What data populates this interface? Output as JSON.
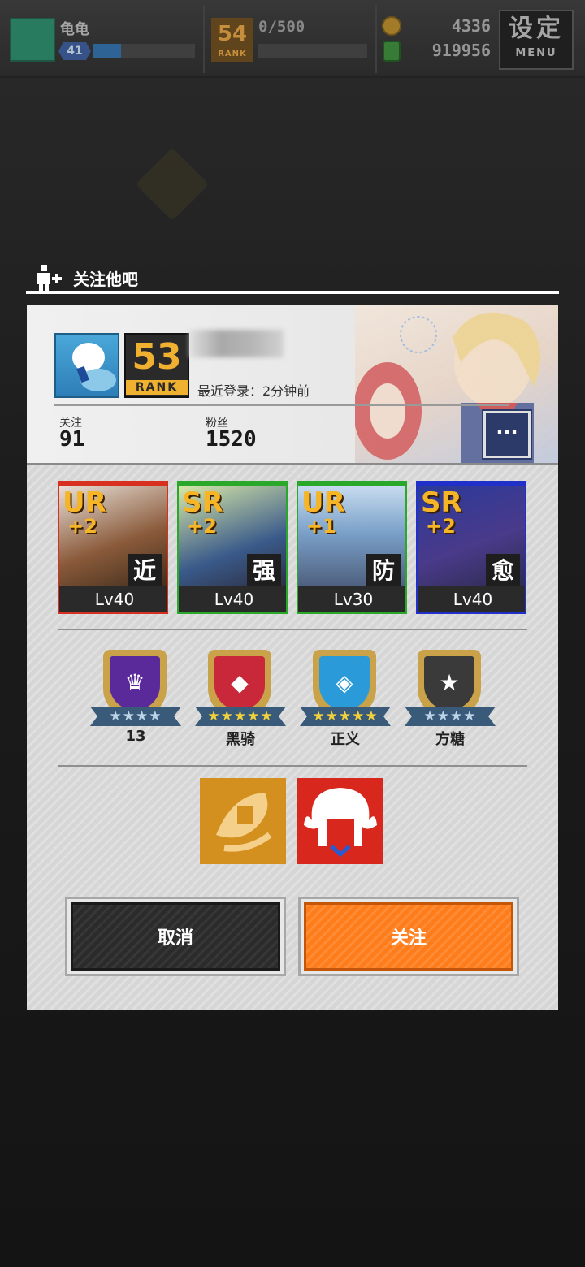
{
  "topbar": {
    "player_name": "龟龟",
    "player_level": "41",
    "exp_fraction": 0.28,
    "rank_label": "RANK",
    "rank_number": "54",
    "rank_points": "0/500",
    "coins": "4336",
    "gems": "919956",
    "menu_label": "设定",
    "menu_sub": "MENU"
  },
  "dialog": {
    "title": "关注他吧",
    "rank_number": "53",
    "rank_label": "RANK",
    "last_login": "最近登录：2分钟前",
    "following_label": "关注",
    "following_value": "91",
    "fans_label": "粉丝",
    "fans_value": "1520",
    "more_label": "···"
  },
  "cards": [
    {
      "rarity": "UR",
      "plus": "+2",
      "role": "近",
      "level": "Lv40",
      "frame_color": "#d83020"
    },
    {
      "rarity": "SR",
      "plus": "+2",
      "role": "强",
      "level": "Lv40",
      "frame_color": "#2aa82a"
    },
    {
      "rarity": "UR",
      "plus": "+1",
      "role": "防",
      "level": "Lv30",
      "frame_color": "#2aa82a"
    },
    {
      "rarity": "SR",
      "plus": "+2",
      "role": "愈",
      "level": "Lv40",
      "frame_color": "#2030c8"
    }
  ],
  "medals": [
    {
      "name": "13",
      "stars": "★★★★",
      "star_color": "#bcd4e8",
      "inner_color": "#5a2a9a",
      "icon": "crown-icon",
      "glyph": "♛"
    },
    {
      "name": "黑骑",
      "stars": "★★★★★",
      "star_color": "#f2d23a",
      "inner_color": "#c8283a",
      "icon": "crystal-icon",
      "glyph": "◆"
    },
    {
      "name": "正义",
      "stars": "★★★★★",
      "star_color": "#f2d23a",
      "inner_color": "#2a9ad8",
      "icon": "justice-icon",
      "glyph": "◈"
    },
    {
      "name": "方糖",
      "stars": "★★★★",
      "star_color": "#bcd4e8",
      "inner_color": "#3a3a3a",
      "icon": "star-chevron-icon",
      "glyph": "★"
    }
  ],
  "skills": [
    {
      "icon": "rocket-fist-icon",
      "color": "#d4901e"
    },
    {
      "icon": "white-hair-face-icon",
      "color": "#d8281e"
    }
  ],
  "buttons": {
    "cancel": "取消",
    "follow": "关注"
  }
}
